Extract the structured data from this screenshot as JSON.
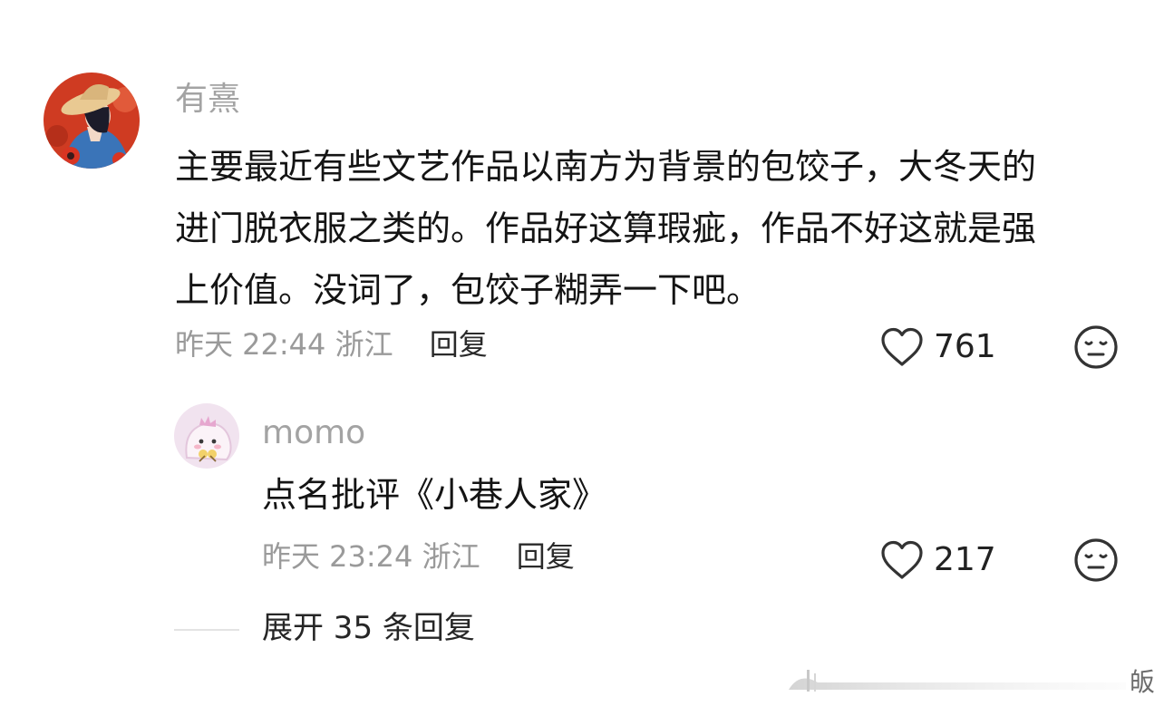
{
  "comments": [
    {
      "username": "有熹",
      "text_lines": [
        "主要最近有些文艺作品以南方为背景的包饺子，大冬天的",
        "进门脱衣服之类的。作品好这算瑕疵，作品不好这就是强",
        "上价值。没词了，包饺子糊弄一下吧。"
      ],
      "time": "昨天 22:44",
      "location": "浙江",
      "reply_label": "回复",
      "likes": "761",
      "avatar_icon": "woman-straw-hat-avatar"
    },
    {
      "username": "momo",
      "text": "点名批评《小巷人家》",
      "time": "昨天 23:24",
      "location": "浙江",
      "reply_label": "回复",
      "likes": "217",
      "avatar_icon": "pink-dinosaur-avatar"
    }
  ],
  "expand": {
    "label": "展开 35 条回复"
  },
  "watermark": {
    "text": "皈"
  },
  "colors": {
    "username": "#a3a3a3",
    "meta": "#9a9a9a",
    "text": "#141414",
    "avatar_bg_main": "#cf3b22",
    "avatar_bg_reply": "#f1e3ef"
  }
}
